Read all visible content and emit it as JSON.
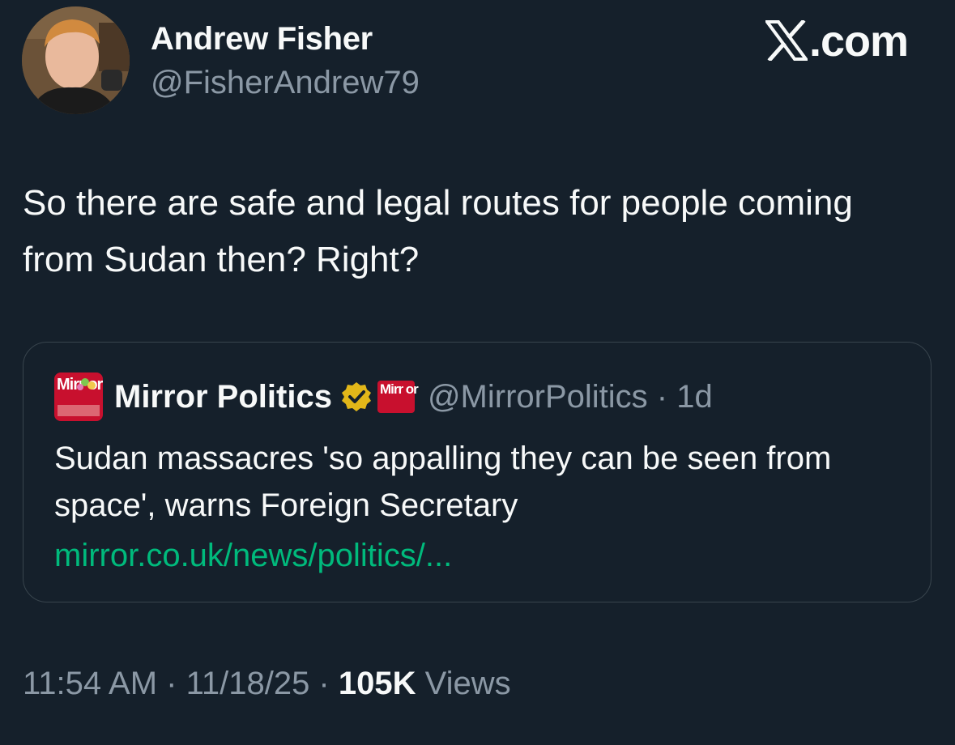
{
  "brand": {
    "site": ".com",
    "logo_icon": "x-logo-icon"
  },
  "author": {
    "name": "Andrew Fisher",
    "handle": "@FisherAndrew79",
    "avatar_icon": "profile-photo"
  },
  "tweet": {
    "text": "So there are safe and legal routes for people coming from Sudan then? Right?"
  },
  "quote": {
    "logo_icon": "mirror-logo",
    "logo_text": "Mirr or",
    "name": "Mirror Politics",
    "verified_icon": "verified-badge-icon",
    "affiliate_badge_text": "Mirr or",
    "handle_time": "@MirrorPolitics · 1d",
    "text": "Sudan massacres 'so appalling they can be seen from space', warns Foreign Secretary",
    "link": "mirror.co.uk/news/politics/..."
  },
  "meta": {
    "time_date": "11:54 AM · 11/18/25 · ",
    "views_count": "105K",
    "views_label": " Views"
  },
  "colors": {
    "background": "#15202b",
    "text_primary": "#f7f9f9",
    "text_secondary": "#8b98a5",
    "link": "#00ba7c",
    "border": "#38444d",
    "verified_gold": "#e2b719",
    "mirror_red": "#c8102e"
  }
}
